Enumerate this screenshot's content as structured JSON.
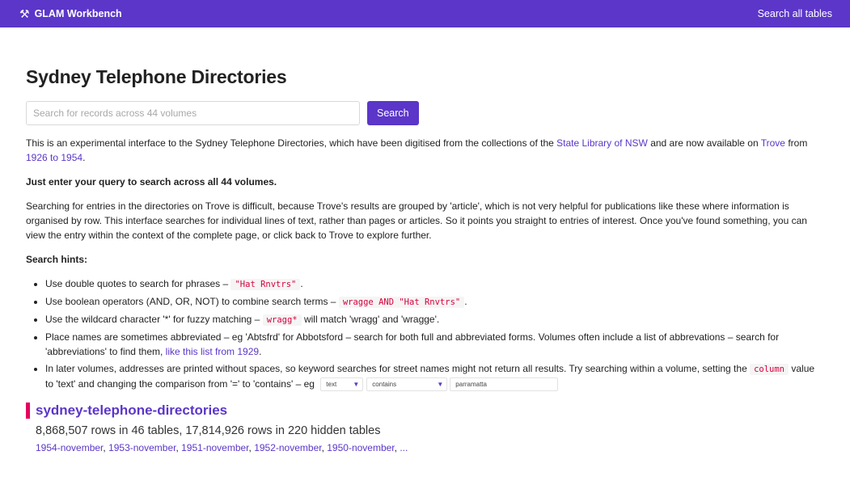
{
  "header": {
    "brand": "GLAM Workbench",
    "search_all": "Search all tables"
  },
  "page": {
    "title": "Sydney Telephone Directories"
  },
  "search": {
    "placeholder": "Search for records across 44 volumes",
    "button": "Search"
  },
  "intro": {
    "p1_a": "This is an experimental interface to the Sydney Telephone Directories, which have been digitised from the collections of the ",
    "p1_link1": "State Library of NSW",
    "p1_b": " and are now available on ",
    "p1_link2": "Trove",
    "p1_c": " from ",
    "p1_link3": "1926 to 1954",
    "p1_d": ".",
    "p2": "Just enter your query to search across all 44 volumes.",
    "p3": "Searching for entries in the directories on Trove is difficult, because Trove's results are grouped by 'article', which is not very helpful for publications like these where information is organised by row. This interface searches for individual lines of text, rather than pages or articles. So it points you straight to entries of interest. Once you've found something, you can view the entry within the context of the complete page, or click back to Trove to explore further.",
    "hints_title": "Search hints:"
  },
  "hints": {
    "h1_a": "Use double quotes to search for phrases – ",
    "h1_code": "\"Hat Rnvtrs\"",
    "h1_b": ".",
    "h2_a": "Use boolean operators (AND, OR, NOT) to combine search terms – ",
    "h2_code": "wragge AND \"Hat Rnvtrs\"",
    "h2_b": ".",
    "h3_a": "Use the wildcard character '*' for fuzzy matching – ",
    "h3_code": "wragg*",
    "h3_b": " will match 'wragg' and 'wragge'.",
    "h4_a": "Place names are sometimes abbreviated – eg 'Abtsfrd' for Abbotsford – search for both full and abbreviated forms. Volumes often include a list of abbrevations – search for 'abbreviations' to find them, ",
    "h4_link": "like this list from 1929",
    "h4_b": ".",
    "h5_a": "In later volumes, addresses are printed without spaces, so keyword searches for street names might not return all results. Try searching within a volume, setting the ",
    "h5_code": "column",
    "h5_b": " value to 'text' and changing the comparison from '=' to 'contains' – eg",
    "ex_column": "text",
    "ex_comparison": "contains",
    "ex_value": "parramatta"
  },
  "database": {
    "name": "sydney-telephone-directories",
    "counts": "8,868,507 rows in 46 tables, 17,814,926 rows in 220 hidden tables",
    "tables": [
      "1954-november",
      "1953-november",
      "1951-november",
      "1952-november",
      "1950-november"
    ],
    "more": "..."
  }
}
